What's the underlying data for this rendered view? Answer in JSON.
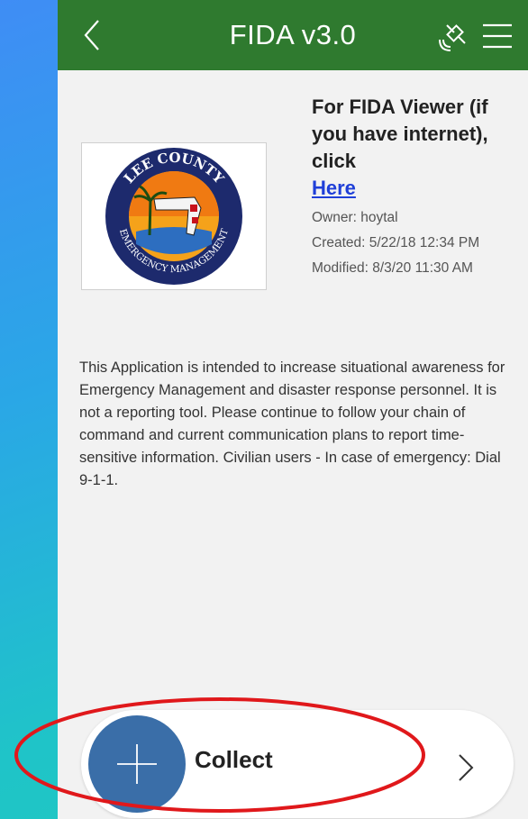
{
  "appbar": {
    "title": "FIDA v3.0",
    "back_icon": "chevron-left-icon",
    "status_icon": "satellite-icon",
    "menu_icon": "hamburger-menu-icon",
    "color": "#2f7a2f"
  },
  "item": {
    "headline": "For FIDA Viewer (if you have internet), click",
    "link_text": "Here",
    "owner": "Owner: hoytal",
    "created": "Created: 5/22/18 12:34 PM",
    "modified": "Modified: 8/3/20 11:30 AM",
    "logo_text_top": "LEE COUNTY",
    "logo_text_bottom": "EMERGENCY MANAGEMENT",
    "description": "This Application is intended to increase situational awareness for Emergency Management and disaster response personnel. It is not a reporting tool. Please continue to follow your chain of command and current communication plans to report time-sensitive information. Civilian users - In case of emergency: Dial 9-1-1."
  },
  "collect": {
    "label": "Collect",
    "icon": "plus-icon",
    "chevron": "chevron-right-icon",
    "accent": "#3a6ea8"
  },
  "annotation_color": "#e0181b"
}
